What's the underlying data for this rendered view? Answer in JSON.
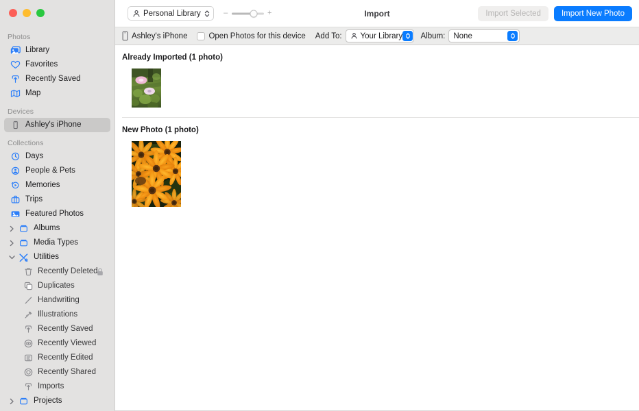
{
  "window": {
    "title": "Import",
    "traffic_lights": [
      "close",
      "minimize",
      "zoom"
    ]
  },
  "toolbar": {
    "library_button": "Personal Library",
    "zoom_minus": "–",
    "zoom_plus": "+",
    "zoom_value_percent": 68,
    "import_selected_label": "Import Selected",
    "import_selected_enabled": false,
    "import_new_label": "Import New Photo",
    "accent_color": "#0a7cff"
  },
  "import_bar": {
    "device_name": "Ashley's iPhone",
    "open_photos_label": "Open Photos for this device",
    "open_photos_checked": false,
    "add_to_label": "Add To:",
    "add_to_value": "Your Library",
    "album_label": "Album:",
    "album_value": "None"
  },
  "sidebar": {
    "sections": [
      {
        "title": "Photos",
        "items": [
          {
            "label": "Library",
            "icon": "photos-library-icon",
            "selected": false
          },
          {
            "label": "Favorites",
            "icon": "heart-icon",
            "selected": false
          },
          {
            "label": "Recently Saved",
            "icon": "save-arrow-icon",
            "selected": false
          },
          {
            "label": "Map",
            "icon": "map-icon",
            "selected": false
          }
        ]
      },
      {
        "title": "Devices",
        "items": [
          {
            "label": "Ashley's iPhone",
            "icon": "iphone-icon",
            "selected": true
          }
        ]
      },
      {
        "title": "Collections",
        "items": [
          {
            "label": "Days",
            "icon": "clock-icon",
            "selected": false
          },
          {
            "label": "People & Pets",
            "icon": "person-circle-icon",
            "selected": false
          },
          {
            "label": "Memories",
            "icon": "memories-play-icon",
            "selected": false
          },
          {
            "label": "Trips",
            "icon": "suitcase-icon",
            "selected": false
          },
          {
            "label": "Featured Photos",
            "icon": "featured-photo-icon",
            "selected": false
          },
          {
            "label": "Albums",
            "icon": "album-folder-icon",
            "disclosure": "collapsed",
            "selected": false
          },
          {
            "label": "Media Types",
            "icon": "album-folder-icon",
            "disclosure": "collapsed",
            "selected": false
          },
          {
            "label": "Utilities",
            "icon": "tools-icon",
            "disclosure": "expanded",
            "selected": false
          },
          {
            "label": "Recently Deleted",
            "icon": "trash-icon",
            "nested": true,
            "trailing_icon": "lock-icon",
            "selected": false
          },
          {
            "label": "Duplicates",
            "icon": "duplicates-icon",
            "nested": true,
            "selected": false
          },
          {
            "label": "Handwriting",
            "icon": "handwriting-icon",
            "nested": true,
            "selected": false
          },
          {
            "label": "Illustrations",
            "icon": "illustrations-icon",
            "nested": true,
            "selected": false
          },
          {
            "label": "Recently Saved",
            "icon": "save-arrow-icon",
            "nested": true,
            "selected": false
          },
          {
            "label": "Recently Viewed",
            "icon": "eye-circle-icon",
            "nested": true,
            "selected": false
          },
          {
            "label": "Recently Edited",
            "icon": "edited-doc-icon",
            "nested": true,
            "selected": false
          },
          {
            "label": "Recently Shared",
            "icon": "shared-circle-icon",
            "nested": true,
            "selected": false
          },
          {
            "label": "Imports",
            "icon": "save-arrow-icon",
            "nested": true,
            "selected": false
          },
          {
            "label": "Projects",
            "icon": "album-folder-icon",
            "disclosure": "collapsed",
            "selected": false
          }
        ]
      }
    ]
  },
  "content": {
    "sections": [
      {
        "heading": "Already Imported (1 photo)",
        "photos": [
          {
            "name": "pink-flowers-thumbnail",
            "width": 43,
            "height": 57
          }
        ]
      },
      {
        "heading": "New Photo (1 photo)",
        "photos": [
          {
            "name": "orange-flowers-thumbnail",
            "width": 72,
            "height": 96
          }
        ]
      }
    ]
  }
}
